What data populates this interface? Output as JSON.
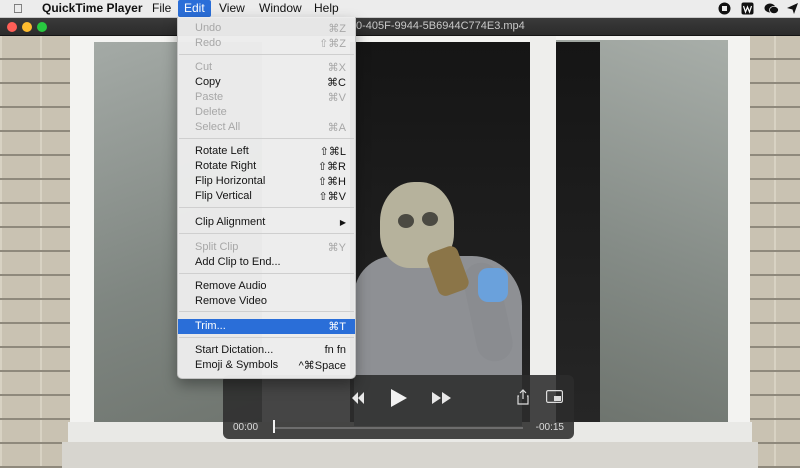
{
  "menubar": {
    "app_name": "QuickTime Player",
    "items": [
      "File",
      "Edit",
      "View",
      "Window",
      "Help"
    ],
    "active": "Edit"
  },
  "tray_icons": [
    "record-icon",
    "app-w-icon",
    "wechat-icon",
    "send-icon"
  ],
  "window": {
    "title_fragment": "0-405F-9944-5B6944C774E3.mp4",
    "lights": [
      "#ff5f57",
      "#febc2e",
      "#28c840"
    ]
  },
  "edit_menu": {
    "rows": [
      {
        "label": "Undo",
        "shortcut": "⌘Z",
        "enabled": false
      },
      {
        "label": "Redo",
        "shortcut": "⇧⌘Z",
        "enabled": false
      },
      {
        "label": "Cut",
        "shortcut": "⌘X",
        "enabled": false
      },
      {
        "label": "Copy",
        "shortcut": "⌘C",
        "enabled": true
      },
      {
        "label": "Paste",
        "shortcut": "⌘V",
        "enabled": false
      },
      {
        "label": "Delete",
        "shortcut": "",
        "enabled": false
      },
      {
        "label": "Select All",
        "shortcut": "⌘A",
        "enabled": false
      },
      {
        "label": "Rotate Left",
        "shortcut": "⇧⌘L",
        "enabled": true
      },
      {
        "label": "Rotate Right",
        "shortcut": "⇧⌘R",
        "enabled": true
      },
      {
        "label": "Flip Horizontal",
        "shortcut": "⇧⌘H",
        "enabled": true
      },
      {
        "label": "Flip Vertical",
        "shortcut": "⇧⌘V",
        "enabled": true
      },
      {
        "label": "Clip Alignment",
        "shortcut": "▶",
        "enabled": true
      },
      {
        "label": "Split Clip",
        "shortcut": "⌘Y",
        "enabled": false
      },
      {
        "label": "Add Clip to End...",
        "shortcut": "",
        "enabled": true
      },
      {
        "label": "Remove Audio",
        "shortcut": "",
        "enabled": true
      },
      {
        "label": "Remove Video",
        "shortcut": "",
        "enabled": true
      },
      {
        "label": "Trim...",
        "shortcut": "⌘T",
        "enabled": true,
        "highlighted": true
      },
      {
        "label": "Start Dictation...",
        "shortcut": "fn fn",
        "enabled": true
      },
      {
        "label": "Emoji & Symbols",
        "shortcut": "^⌘Space",
        "enabled": true
      }
    ]
  },
  "player": {
    "time_current": "00:00",
    "time_remaining": "-00:15",
    "progress": 0.0
  },
  "colors": {
    "accent": "#2a6ed8"
  }
}
